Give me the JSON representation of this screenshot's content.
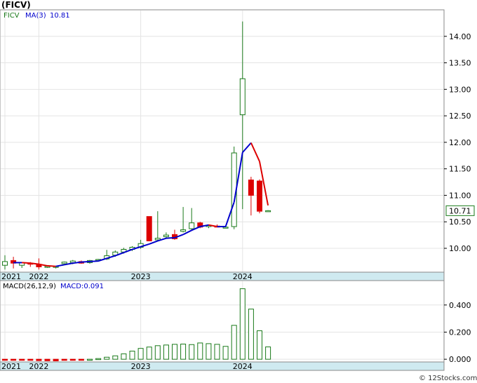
{
  "title": "(FICV)",
  "credit": "© 12Stocks.com",
  "colors": {
    "up": "#1a7a1a",
    "down": "#dd0000",
    "ma_up": "#0000cc",
    "ma_down": "#dd0000",
    "axis_band": "#cfeaf0",
    "grid": "#e4e4e4",
    "macd_bar_pos": "#1a7a1a",
    "macd_bar_neg": "#dd0000",
    "legend_ticker": "#1a7a1a",
    "legend_ma": "#0000cc"
  },
  "chart_data": [
    {
      "type": "candlestick",
      "legend": {
        "ticker": "FICV",
        "ma_label": "MA(3)",
        "ma_value": "10.81"
      },
      "last_price_label": "10.71",
      "ylim": [
        9.55,
        14.5
      ],
      "yticks": [
        "10.00",
        "10.50",
        "11.00",
        "11.50",
        "12.00",
        "12.50",
        "13.00",
        "13.50",
        "14.00"
      ],
      "x_labels": [
        {
          "label": "2021",
          "index": 0
        },
        {
          "label": "2022",
          "index": 4
        },
        {
          "label": "2023",
          "index": 16
        },
        {
          "label": "2024",
          "index": 28
        }
      ],
      "candles": [
        {
          "o": 9.68,
          "h": 9.87,
          "l": 9.6,
          "c": 9.75
        },
        {
          "o": 9.77,
          "h": 9.84,
          "l": 9.62,
          "c": 9.72
        },
        {
          "o": 9.68,
          "h": 9.73,
          "l": 9.63,
          "c": 9.73
        },
        {
          "o": 9.72,
          "h": 9.74,
          "l": 9.65,
          "c": 9.71
        },
        {
          "o": 9.69,
          "h": 9.81,
          "l": 9.6,
          "c": 9.65
        },
        {
          "o": 9.65,
          "h": 9.68,
          "l": 9.63,
          "c": 9.66
        },
        {
          "o": 9.64,
          "h": 9.67,
          "l": 9.62,
          "c": 9.66
        },
        {
          "o": 9.71,
          "h": 9.75,
          "l": 9.69,
          "c": 9.74
        },
        {
          "o": 9.73,
          "h": 9.78,
          "l": 9.7,
          "c": 9.76
        },
        {
          "o": 9.75,
          "h": 9.77,
          "l": 9.71,
          "c": 9.72
        },
        {
          "o": 9.73,
          "h": 9.78,
          "l": 9.71,
          "c": 9.77
        },
        {
          "o": 9.77,
          "h": 9.8,
          "l": 9.75,
          "c": 9.79
        },
        {
          "o": 9.8,
          "h": 9.97,
          "l": 9.78,
          "c": 9.86
        },
        {
          "o": 9.87,
          "h": 9.96,
          "l": 9.84,
          "c": 9.93
        },
        {
          "o": 9.93,
          "h": 10.01,
          "l": 9.9,
          "c": 9.98
        },
        {
          "o": 9.98,
          "h": 10.04,
          "l": 9.95,
          "c": 10.02
        },
        {
          "o": 10.02,
          "h": 10.16,
          "l": 9.99,
          "c": 10.09
        },
        {
          "o": 10.6,
          "h": 10.6,
          "l": 10.14,
          "c": 10.14
        },
        {
          "o": 10.16,
          "h": 10.7,
          "l": 10.14,
          "c": 10.19
        },
        {
          "o": 10.22,
          "h": 10.3,
          "l": 10.19,
          "c": 10.25
        },
        {
          "o": 10.26,
          "h": 10.35,
          "l": 10.16,
          "c": 10.18
        },
        {
          "o": 10.32,
          "h": 10.78,
          "l": 10.3,
          "c": 10.35
        },
        {
          "o": 10.37,
          "h": 10.76,
          "l": 10.35,
          "c": 10.48
        },
        {
          "o": 10.48,
          "h": 10.5,
          "l": 10.38,
          "c": 10.4
        },
        {
          "o": 10.42,
          "h": 10.45,
          "l": 10.38,
          "c": 10.43
        },
        {
          "o": 10.42,
          "h": 10.45,
          "l": 10.4,
          "c": 10.41
        },
        {
          "o": 10.39,
          "h": 10.42,
          "l": 10.38,
          "c": 10.4
        },
        {
          "o": 10.41,
          "h": 11.92,
          "l": 10.36,
          "c": 11.8
        },
        {
          "o": 12.52,
          "h": 14.28,
          "l": 10.74,
          "c": 13.2
        },
        {
          "o": 11.29,
          "h": 11.35,
          "l": 10.62,
          "c": 11.0
        },
        {
          "o": 11.27,
          "h": 11.3,
          "l": 10.66,
          "c": 10.7
        },
        {
          "o": 10.71,
          "h": 10.72,
          "l": 10.7,
          "c": 10.71
        }
      ],
      "ma": [
        {
          "i": 1,
          "v": 9.73
        },
        {
          "i": 2,
          "v": 9.73
        },
        {
          "i": 3,
          "v": 9.72
        },
        {
          "i": 4,
          "v": 9.7
        },
        {
          "i": 5,
          "v": 9.67
        },
        {
          "i": 6,
          "v": 9.66
        },
        {
          "i": 7,
          "v": 9.69
        },
        {
          "i": 8,
          "v": 9.72
        },
        {
          "i": 9,
          "v": 9.74
        },
        {
          "i": 10,
          "v": 9.75
        },
        {
          "i": 11,
          "v": 9.76
        },
        {
          "i": 12,
          "v": 9.81
        },
        {
          "i": 13,
          "v": 9.86
        },
        {
          "i": 14,
          "v": 9.92
        },
        {
          "i": 15,
          "v": 9.98
        },
        {
          "i": 16,
          "v": 10.03
        },
        {
          "i": 17,
          "v": 10.08
        },
        {
          "i": 18,
          "v": 10.14
        },
        {
          "i": 19,
          "v": 10.19
        },
        {
          "i": 20,
          "v": 10.2
        },
        {
          "i": 21,
          "v": 10.26
        },
        {
          "i": 22,
          "v": 10.34
        },
        {
          "i": 23,
          "v": 10.41
        },
        {
          "i": 24,
          "v": 10.44
        },
        {
          "i": 25,
          "v": 10.41
        },
        {
          "i": 26,
          "v": 10.41
        },
        {
          "i": 27,
          "v": 10.87
        },
        {
          "i": 28,
          "v": 11.81
        },
        {
          "i": 29,
          "v": 11.99
        },
        {
          "i": 30,
          "v": 11.64
        },
        {
          "i": 31,
          "v": 10.81
        }
      ]
    },
    {
      "type": "bar",
      "legend": {
        "label": "MACD(26,12,9)",
        "value_label": "MACD:0.091"
      },
      "ylim": [
        -0.02,
        0.58
      ],
      "yticks": [
        "0.000",
        "0.200",
        "0.400"
      ],
      "x_labels": [
        {
          "label": "2021",
          "index": 0
        },
        {
          "label": "2022",
          "index": 4
        },
        {
          "label": "2023",
          "index": 16
        },
        {
          "label": "2024",
          "index": 28
        }
      ],
      "values": [
        -0.004,
        -0.006,
        -0.007,
        -0.008,
        -0.01,
        -0.011,
        -0.012,
        -0.008,
        -0.005,
        -0.003,
        0.0,
        0.005,
        0.015,
        0.025,
        0.04,
        0.06,
        0.08,
        0.09,
        0.1,
        0.105,
        0.11,
        0.112,
        0.108,
        0.12,
        0.115,
        0.11,
        0.095,
        0.25,
        0.52,
        0.37,
        0.21,
        0.091
      ]
    }
  ]
}
